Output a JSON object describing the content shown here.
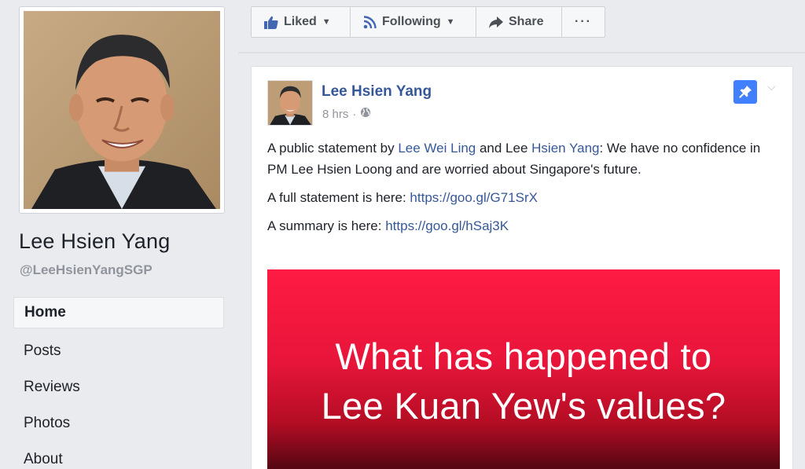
{
  "page": {
    "name": "Lee Hsien Yang",
    "handle": "@LeeHsienYangSGP"
  },
  "nav": {
    "items": [
      {
        "label": "Home"
      },
      {
        "label": "Posts"
      },
      {
        "label": "Reviews"
      },
      {
        "label": "Photos"
      },
      {
        "label": "About"
      }
    ]
  },
  "actions": {
    "liked": "Liked",
    "following": "Following",
    "share": "Share",
    "more": "···"
  },
  "post": {
    "author": "Lee Hsien Yang",
    "time": "8 hrs",
    "separator": "·",
    "text_part1": "A public statement by ",
    "link_person1": "Lee Wei Ling",
    "text_and": " and Lee ",
    "link_person2": "Hsien Yang",
    "text_part2": ": We have no confidence in PM Lee Hsien Loong and are worried about Singapore's future.",
    "full_label": "A full statement is here: ",
    "full_link": "https://goo.gl/G71SrX",
    "summary_label": "A summary is here: ",
    "summary_link": "https://goo.gl/hSaj3K",
    "image_line1": "What has happened to",
    "image_line2": "Lee Kuan Yew's values?"
  },
  "colors": {
    "link": "#365899",
    "pin": "#4080ff",
    "image_red": "#e8153a"
  },
  "icons": [
    "thumbs-up-icon",
    "rss-icon",
    "share-arrow-icon",
    "globe-icon",
    "pin-icon",
    "chevron-down-icon"
  ]
}
